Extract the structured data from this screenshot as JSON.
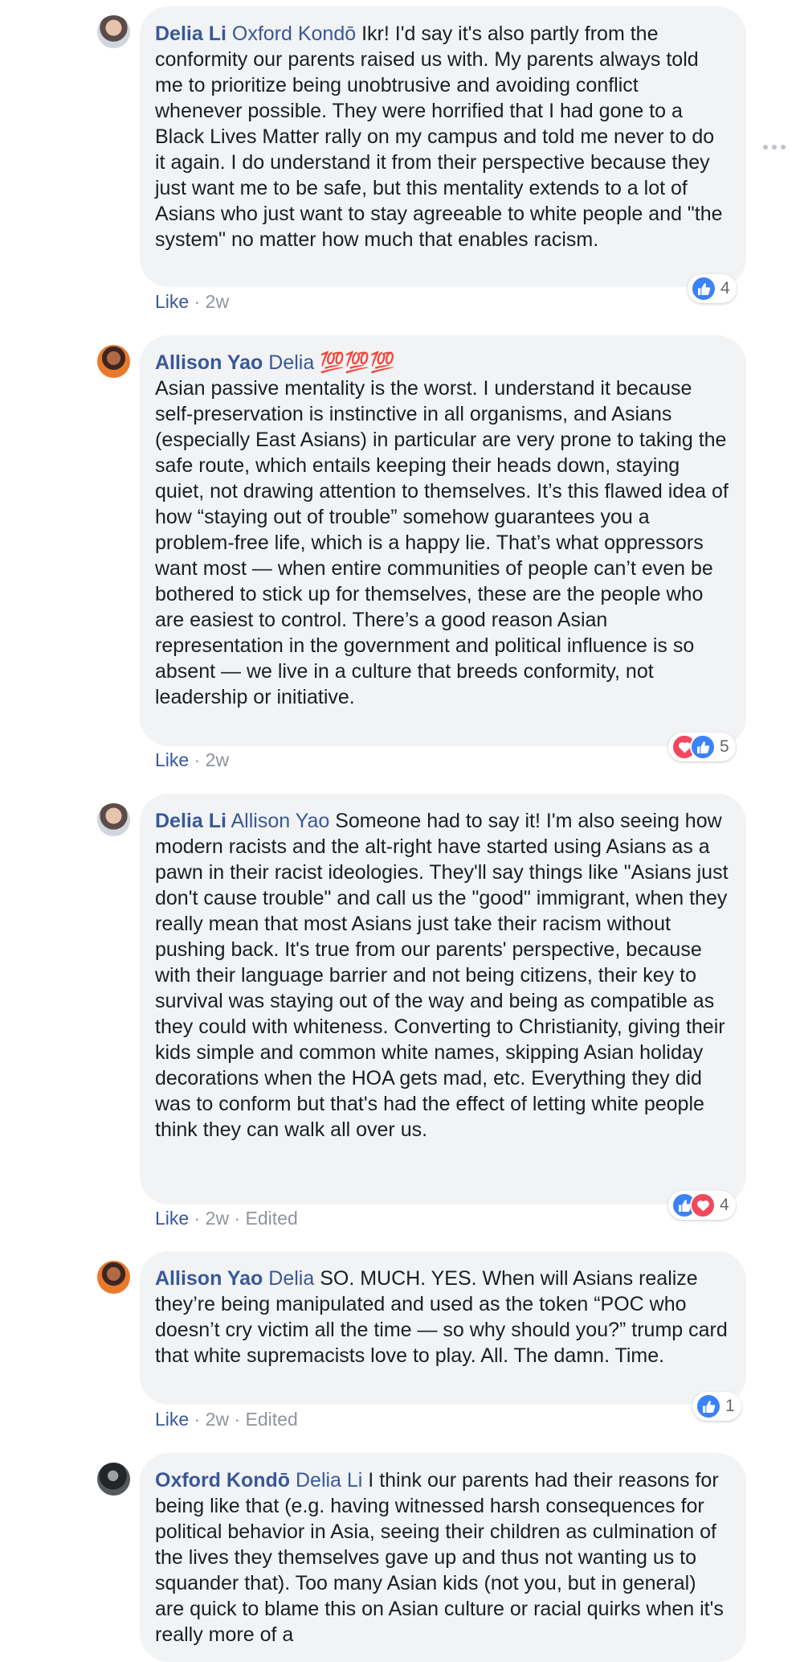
{
  "comments": [
    {
      "author": "Delia Li",
      "mention": "Oxford Kondō",
      "text": " Ikr! I'd say it's also partly from the conformity our parents raised us with. My parents always told me to prioritize being unobtrusive and avoiding conflict whenever possible. They were horrified that I had gone to a Black Lives Matter rally on my campus and told me never to do it again. I do understand it from their perspective because they just want me to be safe, but this mentality extends to a lot of Asians who just want to stay agreeable to white people and \"the system\" no matter how much that enables racism.",
      "like_label": "Like",
      "time": "2w",
      "edited": "",
      "reaction_count": "4",
      "reactions": [
        "like"
      ]
    },
    {
      "author": "Allison Yao",
      "mention": "Delia",
      "emoji": "💯💯💯",
      "text": "Asian passive mentality is the worst. I understand it because self-preservation is instinctive in all organisms, and Asians (especially East Asians) in particular are very prone to taking the safe route, which entails keeping their heads down, staying quiet, not drawing attention to themselves. It’s this flawed idea of how “staying out of trouble” somehow guarantees you a problem-free life, which is a happy lie. That’s what oppressors want most — when entire communities of people can’t even be bothered to stick up for themselves, these are the people who are easiest to control. There’s a good reason Asian representation in the government and political influence is so absent — we live in a culture that breeds conformity, not leadership or initiative.",
      "like_label": "Like",
      "time": "2w",
      "edited": "",
      "reaction_count": "5",
      "reactions": [
        "love",
        "like"
      ]
    },
    {
      "author": "Delia Li",
      "mention": "Allison Yao",
      "text": " Someone had to say it! I'm also seeing how modern racists and the alt-right have started using Asians as a pawn in their racist ideologies. They'll say things like \"Asians just don't cause trouble\" and call us the \"good\" immigrant, when they really mean that most Asians just take their racism without pushing back. It's true from our parents' perspective, because with their language barrier and not being citizens, their key to survival was staying out of the way and being as compatible as they could with whiteness. Converting to Christianity, giving their kids simple and common white names, skipping Asian holiday decorations when the HOA gets mad, etc. Everything they did was to conform but that's had the effect of letting white people think they can walk all over us.",
      "like_label": "Like",
      "time": "2w",
      "edited": "Edited",
      "reaction_count": "4",
      "reactions": [
        "like",
        "love"
      ]
    },
    {
      "author": "Allison Yao",
      "mention": "Delia",
      "text": " SO. MUCH. YES. When will Asians realize they’re being manipulated and used as the token “POC who doesn’t cry victim all the time — so why should you?” trump card that white supremacists love to play. All. The damn. Time.",
      "like_label": "Like",
      "time": "2w",
      "edited": "Edited",
      "reaction_count": "1",
      "reactions": [
        "like"
      ]
    },
    {
      "author": "Oxford Kondō",
      "mention": "Delia Li",
      "text": " I think our parents had their reasons for being like that (e.g. having witnessed harsh consequences for political behavior in Asia, seeing their children as culmination of the lives they themselves gave up and thus not wanting us to squander that). Too many Asian kids (not you, but in general) are quick to blame this on Asian culture or racial quirks when it's really more of a"
    }
  ],
  "separator": " · ",
  "colors": {
    "link": "#385898",
    "bubble": "#f2f3f5",
    "meta": "#90949c",
    "like": "#3b82f6",
    "love": "#f2475d"
  }
}
